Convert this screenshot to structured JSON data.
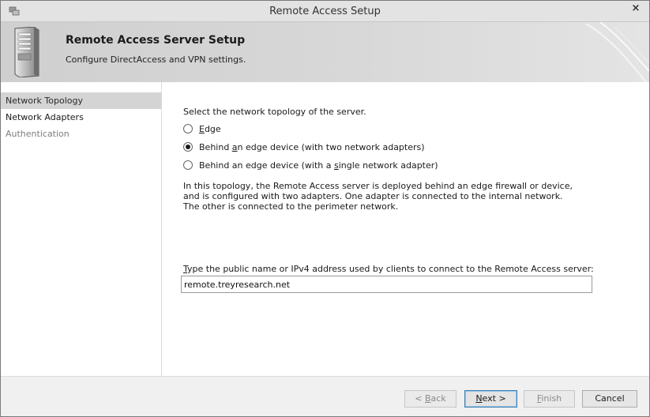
{
  "window": {
    "title": "Remote Access Setup",
    "close_glyph": "×",
    "app_icon": "remote-access-icon"
  },
  "banner": {
    "title": "Remote Access Server Setup",
    "subtitle": "Configure DirectAccess and VPN settings.",
    "icon": "server-icon"
  },
  "nav": {
    "items": [
      {
        "label": "Network Topology",
        "state": "selected"
      },
      {
        "label": "Network Adapters",
        "state": "normal"
      },
      {
        "label": "Authentication",
        "state": "disabled"
      }
    ]
  },
  "topology": {
    "prompt": "Select the network topology of the server.",
    "options": [
      {
        "pre": "",
        "access_key": "E",
        "post": "dge",
        "checked": false
      },
      {
        "pre": "Behind ",
        "access_key": "a",
        "post": "n edge device (with two network adapters)",
        "checked": true
      },
      {
        "pre": "Behind an edge device (with a ",
        "access_key": "s",
        "post": "ingle network adapter)",
        "checked": false
      }
    ],
    "description": "In this topology, the Remote Access server is deployed behind an edge firewall or device, and is configured with two adapters. One adapter is connected to the internal network. The other is connected to the perimeter network."
  },
  "public_name": {
    "label_access_key": "T",
    "label_rest": "ype the public name or IPv4 address used by clients to connect to the Remote Access server:",
    "value": "remote.treyresearch.net"
  },
  "footer": {
    "back": {
      "pre": "< ",
      "access_key": "B",
      "post": "ack"
    },
    "next": {
      "pre": "",
      "access_key": "N",
      "post": "ext >"
    },
    "finish": {
      "pre": "",
      "access_key": "F",
      "post": "inish"
    },
    "cancel": "Cancel"
  }
}
